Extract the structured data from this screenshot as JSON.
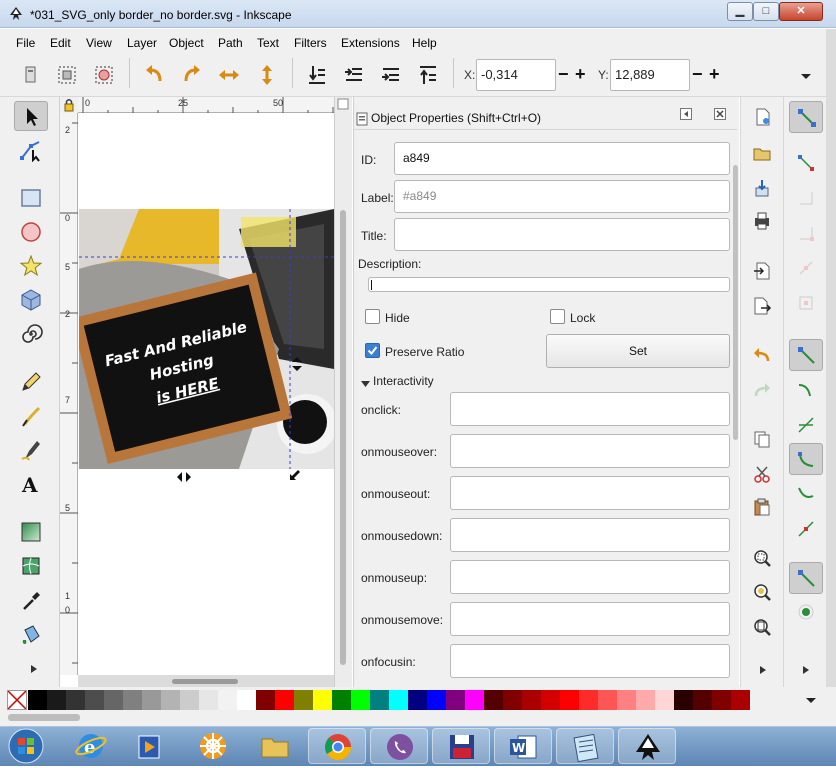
{
  "window": {
    "title": "*031_SVG_only border_no border.svg - Inkscape",
    "min_glyph": "▁",
    "max_glyph": "□",
    "close_glyph": "✕"
  },
  "menu": [
    "File",
    "Edit",
    "View",
    "Layer",
    "Object",
    "Path",
    "Text",
    "Filters",
    "Extensions",
    "Help"
  ],
  "coords": {
    "x_label": "X:",
    "x_value": "-0,314",
    "y_label": "Y:",
    "y_value": "12,889",
    "minus": "−",
    "plus": "+"
  },
  "ruler": {
    "top": [
      "0",
      "25",
      "50"
    ],
    "left": [
      "2",
      "0",
      "5",
      "2",
      "7",
      "5",
      "1",
      "0"
    ]
  },
  "artwork": {
    "line1": "Fast And Reliable",
    "line2": "Hosting",
    "line3": "is HERE"
  },
  "panel": {
    "title": "Object Properties (Shift+Ctrl+O)",
    "id_label": "ID:",
    "id_value": "a849",
    "label_label": "Label:",
    "label_placeholder": "#a849",
    "title_label": "Title:",
    "title_value": "",
    "description_label": "Description:",
    "hide_label": "Hide",
    "lock_label": "Lock",
    "preserve_label": "Preserve Ratio",
    "set_label": "Set",
    "interactivity_label": "Interactivity",
    "events": [
      "onclick:",
      "onmouseover:",
      "onmouseout:",
      "onmousedown:",
      "onmouseup:",
      "onmousemove:",
      "onfocusin:"
    ],
    "checkbox_state": {
      "hide": false,
      "lock": false,
      "preserve_ratio": true
    }
  },
  "palette": [
    "#000000",
    "#1a1a1a",
    "#333333",
    "#4d4d4d",
    "#666666",
    "#808080",
    "#999999",
    "#b3b3b3",
    "#cccccc",
    "#e6e6e6",
    "#f2f2f2",
    "#ffffff",
    "#800000",
    "#ff0000",
    "#808000",
    "#ffff00",
    "#008000",
    "#00ff00",
    "#008080",
    "#00ffff",
    "#000080",
    "#0000ff",
    "#800080",
    "#ff00ff",
    "#550000",
    "#800000",
    "#aa0000",
    "#d40000",
    "#ff0000",
    "#ff2a2a",
    "#ff5555",
    "#ff8080",
    "#ffaaaa",
    "#ffd5d5",
    "#2b0000",
    "#550000",
    "#800000",
    "#aa0000"
  ],
  "colors": {
    "accent": "#3b7fd4",
    "title_bar": "#c7d8ee",
    "taskbar": "#5e86b4"
  },
  "taskbar": {
    "items": [
      "start-orb-icon",
      "internet-explorer-icon",
      "media-player-icon",
      "helm-app-icon",
      "file-explorer-icon",
      "chrome-icon",
      "viber-icon",
      "save-floppy-icon",
      "word-icon",
      "notepad-icon",
      "inkscape-icon"
    ]
  }
}
